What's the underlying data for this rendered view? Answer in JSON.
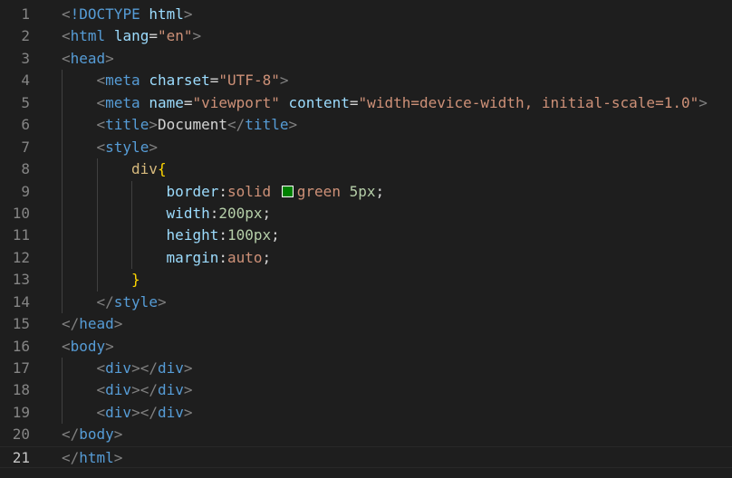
{
  "editor": {
    "theme_colors": {
      "background": "#1e1e1e",
      "tag": "#569cd6",
      "attribute": "#9cdcfe",
      "string": "#ce9178",
      "number": "#b5cea8",
      "selector": "#d7ba7d",
      "brace": "#ffd700",
      "punctuation": "#808080",
      "swatch_color": "#008000"
    },
    "active_line": 21,
    "lines": [
      {
        "n": "1",
        "indent": 0,
        "tokens": [
          [
            "t-bracket",
            "<"
          ],
          [
            "t-tag",
            "!DOCTYPE"
          ],
          [
            "t-text",
            " "
          ],
          [
            "t-attr",
            "html"
          ],
          [
            "t-bracket",
            ">"
          ]
        ]
      },
      {
        "n": "2",
        "indent": 0,
        "tokens": [
          [
            "t-bracket",
            "<"
          ],
          [
            "t-tag",
            "html"
          ],
          [
            "t-text",
            " "
          ],
          [
            "t-attr",
            "lang"
          ],
          [
            "t-text",
            "="
          ],
          [
            "t-str",
            "\"en\""
          ],
          [
            "t-bracket",
            ">"
          ]
        ]
      },
      {
        "n": "3",
        "indent": 0,
        "tokens": [
          [
            "t-bracket",
            "<"
          ],
          [
            "t-tag",
            "head"
          ],
          [
            "t-bracket",
            ">"
          ]
        ]
      },
      {
        "n": "4",
        "indent": 1,
        "tokens": [
          [
            "t-bracket",
            "<"
          ],
          [
            "t-tag",
            "meta"
          ],
          [
            "t-text",
            " "
          ],
          [
            "t-attr",
            "charset"
          ],
          [
            "t-text",
            "="
          ],
          [
            "t-str",
            "\"UTF-8\""
          ],
          [
            "t-bracket",
            ">"
          ]
        ]
      },
      {
        "n": "5",
        "indent": 1,
        "tokens": [
          [
            "t-bracket",
            "<"
          ],
          [
            "t-tag",
            "meta"
          ],
          [
            "t-text",
            " "
          ],
          [
            "t-attr",
            "name"
          ],
          [
            "t-text",
            "="
          ],
          [
            "t-str",
            "\"viewport\""
          ],
          [
            "t-text",
            " "
          ],
          [
            "t-attr",
            "content"
          ],
          [
            "t-text",
            "="
          ],
          [
            "t-str",
            "\"width=device-width, initial-scale=1.0\""
          ],
          [
            "t-bracket",
            ">"
          ]
        ]
      },
      {
        "n": "6",
        "indent": 1,
        "tokens": [
          [
            "t-bracket",
            "<"
          ],
          [
            "t-tag",
            "title"
          ],
          [
            "t-bracket",
            ">"
          ],
          [
            "t-text",
            "Document"
          ],
          [
            "t-bracket",
            "</"
          ],
          [
            "t-tag",
            "title"
          ],
          [
            "t-bracket",
            ">"
          ]
        ]
      },
      {
        "n": "7",
        "indent": 1,
        "tokens": [
          [
            "t-bracket",
            "<"
          ],
          [
            "t-tag",
            "style"
          ],
          [
            "t-bracket",
            ">"
          ]
        ]
      },
      {
        "n": "8",
        "indent": 2,
        "tokens": [
          [
            "t-sel",
            "div"
          ],
          [
            "t-brace",
            "{"
          ]
        ]
      },
      {
        "n": "9",
        "indent": 3,
        "tokens": [
          [
            "t-prop",
            "border"
          ],
          [
            "t-text",
            ":"
          ],
          [
            "t-val",
            "solid "
          ],
          [
            "swatch",
            ""
          ],
          [
            "t-val",
            "green "
          ],
          [
            "t-num",
            "5px"
          ],
          [
            "t-text",
            ";"
          ]
        ]
      },
      {
        "n": "10",
        "indent": 3,
        "tokens": [
          [
            "t-prop",
            "width"
          ],
          [
            "t-text",
            ":"
          ],
          [
            "t-num",
            "200px"
          ],
          [
            "t-text",
            ";"
          ]
        ]
      },
      {
        "n": "11",
        "indent": 3,
        "tokens": [
          [
            "t-prop",
            "height"
          ],
          [
            "t-text",
            ":"
          ],
          [
            "t-num",
            "100px"
          ],
          [
            "t-text",
            ";"
          ]
        ]
      },
      {
        "n": "12",
        "indent": 3,
        "tokens": [
          [
            "t-prop",
            "margin"
          ],
          [
            "t-text",
            ":"
          ],
          [
            "t-val",
            "auto"
          ],
          [
            "t-text",
            ";"
          ]
        ]
      },
      {
        "n": "13",
        "indent": 2,
        "tokens": [
          [
            "t-brace",
            "}"
          ]
        ]
      },
      {
        "n": "14",
        "indent": 1,
        "tokens": [
          [
            "t-bracket",
            "</"
          ],
          [
            "t-tag",
            "style"
          ],
          [
            "t-bracket",
            ">"
          ]
        ]
      },
      {
        "n": "15",
        "indent": 0,
        "tokens": [
          [
            "t-bracket",
            "</"
          ],
          [
            "t-tag",
            "head"
          ],
          [
            "t-bracket",
            ">"
          ]
        ]
      },
      {
        "n": "16",
        "indent": 0,
        "tokens": [
          [
            "t-bracket",
            "<"
          ],
          [
            "t-tag",
            "body"
          ],
          [
            "t-bracket",
            ">"
          ]
        ]
      },
      {
        "n": "17",
        "indent": 1,
        "tokens": [
          [
            "t-bracket",
            "<"
          ],
          [
            "t-tag",
            "div"
          ],
          [
            "t-bracket",
            "></"
          ],
          [
            "t-tag",
            "div"
          ],
          [
            "t-bracket",
            ">"
          ]
        ]
      },
      {
        "n": "18",
        "indent": 1,
        "tokens": [
          [
            "t-bracket",
            "<"
          ],
          [
            "t-tag",
            "div"
          ],
          [
            "t-bracket",
            "></"
          ],
          [
            "t-tag",
            "div"
          ],
          [
            "t-bracket",
            ">"
          ]
        ]
      },
      {
        "n": "19",
        "indent": 1,
        "tokens": [
          [
            "t-bracket",
            "<"
          ],
          [
            "t-tag",
            "div"
          ],
          [
            "t-bracket",
            "></"
          ],
          [
            "t-tag",
            "div"
          ],
          [
            "t-bracket",
            ">"
          ]
        ]
      },
      {
        "n": "20",
        "indent": 0,
        "tokens": [
          [
            "t-bracket",
            "</"
          ],
          [
            "t-tag",
            "body"
          ],
          [
            "t-bracket",
            ">"
          ]
        ]
      },
      {
        "n": "21",
        "indent": 0,
        "tokens": [
          [
            "t-bracket",
            "</"
          ],
          [
            "t-tag",
            "html"
          ],
          [
            "t-bracket",
            ">"
          ]
        ]
      }
    ]
  }
}
